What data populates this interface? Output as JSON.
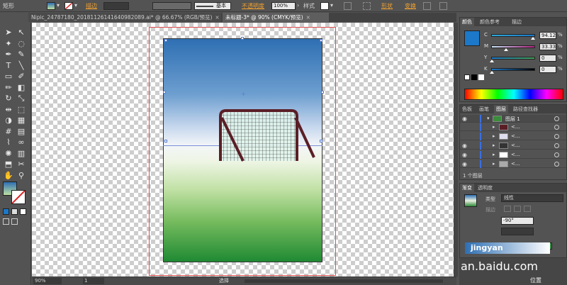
{
  "control_bar": {
    "tool_name": "矩形",
    "stroke_label": "描边",
    "style_name": "基本",
    "opacity_label": "不透明度",
    "opacity_value": "100%",
    "style_label": "样式",
    "shape_label": "形状",
    "transform_label": "变换"
  },
  "tabs": [
    {
      "label": "Nipic_24787180_20181126141640982089.ai* @ 66.67% (RGB/预览)",
      "close": "×",
      "active": false
    },
    {
      "label": "未标题-3* @ 90% (CMYK/预览)",
      "close": "×",
      "active": true
    }
  ],
  "tools": [
    {
      "name": "selection-tool",
      "glyph": "➤"
    },
    {
      "name": "direct-selection-tool",
      "glyph": "↖"
    },
    {
      "name": "magic-wand-tool",
      "glyph": "✦"
    },
    {
      "name": "lasso-tool",
      "glyph": "◌"
    },
    {
      "name": "pen-tool",
      "glyph": "✒"
    },
    {
      "name": "curvature-tool",
      "glyph": "✎"
    },
    {
      "name": "type-tool",
      "glyph": "T"
    },
    {
      "name": "line-tool",
      "glyph": "╲"
    },
    {
      "name": "rectangle-tool",
      "glyph": "▭"
    },
    {
      "name": "paintbrush-tool",
      "glyph": "✐"
    },
    {
      "name": "pencil-tool",
      "glyph": "✏"
    },
    {
      "name": "eraser-tool",
      "glyph": "◧"
    },
    {
      "name": "rotate-tool",
      "glyph": "↻"
    },
    {
      "name": "scale-tool",
      "glyph": "⤡"
    },
    {
      "name": "width-tool",
      "glyph": "⇹"
    },
    {
      "name": "free-transform-tool",
      "glyph": "⬚"
    },
    {
      "name": "shape-builder-tool",
      "glyph": "◑"
    },
    {
      "name": "perspective-tool",
      "glyph": "▦"
    },
    {
      "name": "mesh-tool",
      "glyph": "#"
    },
    {
      "name": "gradient-tool",
      "glyph": "▤"
    },
    {
      "name": "eyedropper-tool",
      "glyph": "⌇"
    },
    {
      "name": "blend-tool",
      "glyph": "∞"
    },
    {
      "name": "symbol-sprayer-tool",
      "glyph": "✺"
    },
    {
      "name": "column-graph-tool",
      "glyph": "▥"
    },
    {
      "name": "artboard-tool",
      "glyph": "⬒"
    },
    {
      "name": "slice-tool",
      "glyph": "✂"
    },
    {
      "name": "hand-tool",
      "glyph": "✋"
    },
    {
      "name": "zoom-tool",
      "glyph": "⚲"
    }
  ],
  "status": {
    "zoom": "90%",
    "page": "1",
    "mode": "选择"
  },
  "color_panel": {
    "tabs": [
      "颜色",
      "颜色参考",
      "描边"
    ],
    "channels": [
      {
        "label": "C",
        "value": "94.12",
        "unit": "%",
        "fraction": 0.94
      },
      {
        "label": "M",
        "value": "33.33",
        "unit": "%",
        "fraction": 0.33
      },
      {
        "label": "Y",
        "value": "0",
        "unit": "%",
        "fraction": 0.0
      },
      {
        "label": "K",
        "value": "0",
        "unit": "%",
        "fraction": 0.0
      }
    ],
    "fill_color": "#1c78c8"
  },
  "layers_panel": {
    "tabs": [
      "色板",
      "画笔",
      "图层",
      "路径查找器"
    ],
    "layer_name": "图层 1",
    "sublayers": [
      "<...",
      "<...",
      "<...",
      "<...",
      "<..."
    ],
    "footer": "1 个图层"
  },
  "gradient_panel": {
    "tabs": [
      "渐变",
      "透明度"
    ],
    "type_label": "类型",
    "type_value": "线性",
    "stroke_label": "描边",
    "angle_value": "-90°"
  },
  "watermark": {
    "text": "an.baidu.com",
    "logo_text": "jingyan",
    "footer_text": "位置"
  },
  "colors": {
    "accent_blue": "#3c6fe0",
    "bleed_red": "#e25050",
    "goal_frame": "#5a1f26"
  }
}
